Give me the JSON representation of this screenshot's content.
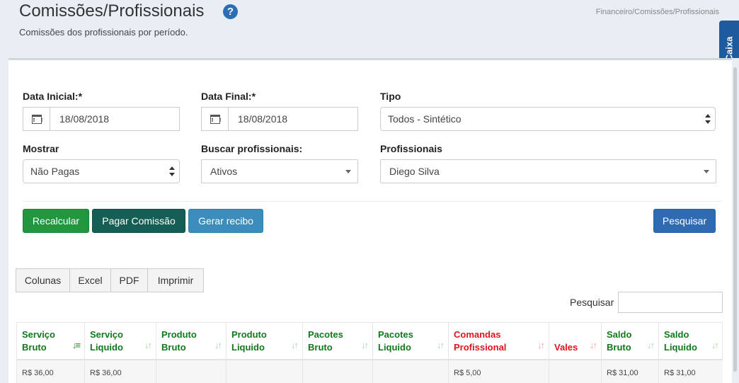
{
  "header": {
    "title": "Comissões/Profissionais",
    "subtitle": "Comissões dos profissionais por período.",
    "breadcrumb": "Financeiro/Comissões/Profissionais",
    "help_icon": "question-circle-icon"
  },
  "side_tab": {
    "label": "Caixa"
  },
  "filters": {
    "data_inicial": {
      "label": "Data Inicial:*",
      "value": "18/08/2018"
    },
    "data_final": {
      "label": "Data Final:*",
      "value": "18/08/2018"
    },
    "tipo": {
      "label": "Tipo",
      "value": "Todos - Sintético"
    },
    "mostrar": {
      "label": "Mostrar",
      "value": "Não Pagas"
    },
    "buscar_profissionais": {
      "label": "Buscar profissionais:",
      "value": "Ativos"
    },
    "profissionais": {
      "label": "Profissionais",
      "value": "Diego Silva"
    }
  },
  "actions": {
    "recalcular": "Recalcular",
    "pagar_comissao": "Pagar Comissão",
    "gerar_recibo": "Gerar recibo",
    "pesquisar": "Pesquisar"
  },
  "export_buttons": [
    "Colunas",
    "Excel",
    "PDF",
    "Imprimir"
  ],
  "table_search": {
    "label": "Pesquisar",
    "value": ""
  },
  "table": {
    "columns": [
      {
        "line1": "Serviço",
        "line2": "Bruto",
        "color": "#12781e"
      },
      {
        "line1": "Serviço",
        "line2": "Liquido",
        "color": "#12781e"
      },
      {
        "line1": "Produto",
        "line2": "Bruto",
        "color": "#12781e"
      },
      {
        "line1": "Produto",
        "line2": "Liquido",
        "color": "#12781e"
      },
      {
        "line1": "Pacotes",
        "line2": "Bruto",
        "color": "#12781e"
      },
      {
        "line1": "Pacotes",
        "line2": "Liquido",
        "color": "#12781e"
      },
      {
        "line1": "Comandas",
        "line2": "Profissional",
        "color": "#e0141e"
      },
      {
        "line1": "",
        "line2": "Vales",
        "color": "#e0141e"
      },
      {
        "line1": "Saldo",
        "line2": "Bruto",
        "color": "#12781e"
      },
      {
        "line1": "Saldo",
        "line2": "Liquido",
        "color": "#12781e"
      }
    ],
    "sort_glyph": "↓↑",
    "rows": [
      [
        "R$ 36,00",
        "R$ 36,00",
        "",
        "",
        "",
        "",
        "R$ 5,00",
        "",
        "R$ 31,00",
        "R$ 31,00"
      ]
    ]
  }
}
